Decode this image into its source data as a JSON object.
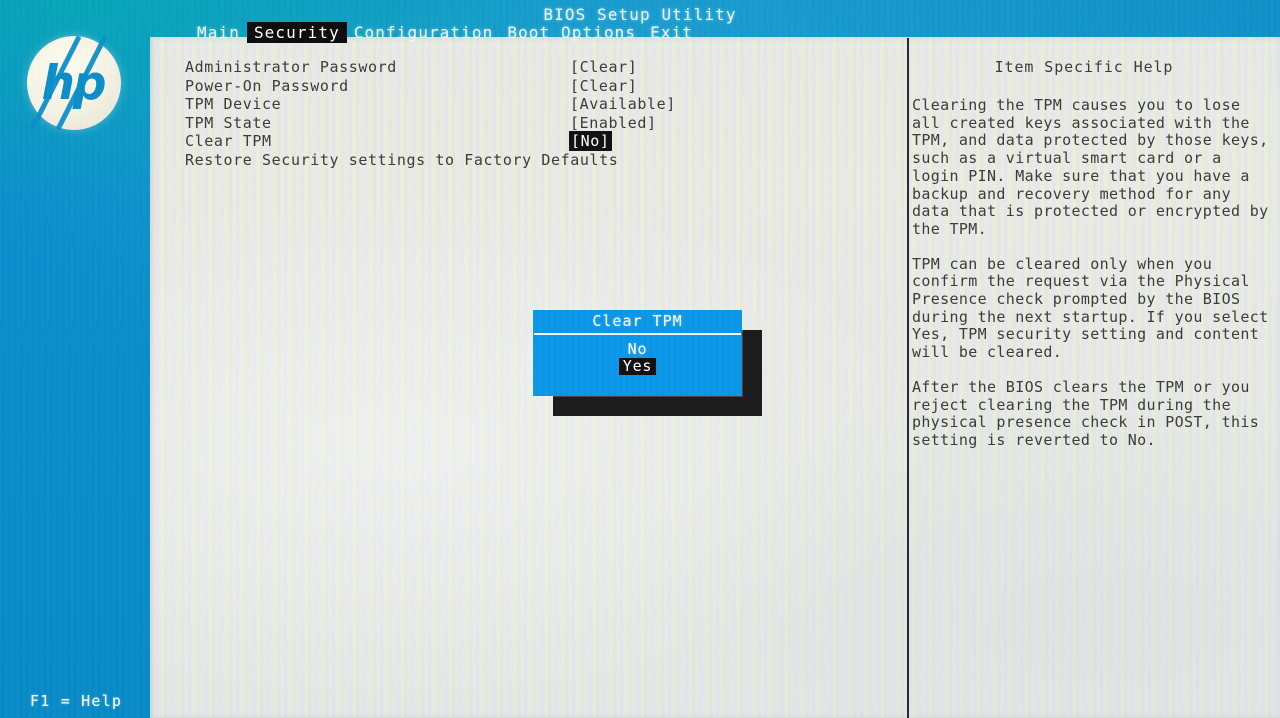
{
  "app": {
    "title": "BIOS Setup Utility",
    "vendor_logo": "hp-logo",
    "logo_text": "hp"
  },
  "menubar": {
    "items": [
      {
        "label": "Main",
        "active": false
      },
      {
        "label": "Security",
        "active": true
      },
      {
        "label": "Configuration",
        "active": false
      },
      {
        "label": "Boot Options",
        "active": false
      },
      {
        "label": "Exit",
        "active": false
      }
    ]
  },
  "settings": {
    "rows": [
      {
        "label": "Administrator Password",
        "value": "[Clear]",
        "selected": false
      },
      {
        "label": "Power-On Password",
        "value": "[Clear]",
        "selected": false
      },
      {
        "label": "TPM Device",
        "value": "[Available]",
        "selected": false
      },
      {
        "label": "TPM State",
        "value": "[Enabled]",
        "selected": false
      },
      {
        "label": "Clear TPM",
        "value": "[No]",
        "selected": true
      },
      {
        "label": "Restore Security settings to Factory Defaults",
        "value": "",
        "selected": false
      }
    ]
  },
  "help": {
    "title": "Item Specific Help",
    "paragraphs": [
      "Clearing the TPM causes you to lose all created keys associated with the TPM, and data protected by those keys, such as a virtual smart card or a login PIN. Make sure that you have a backup and recovery method for any data that is protected or encrypted by the TPM.",
      "TPM can be cleared only when you confirm the request via the Physical Presence check prompted by the BIOS during the next startup. If you select Yes, TPM security setting and content will be cleared.",
      "After the BIOS clears the TPM or you reject clearing the TPM during the physical presence check in POST, this setting is reverted to No."
    ]
  },
  "dialog": {
    "title": "Clear TPM",
    "options": [
      {
        "label": "No",
        "selected": false
      },
      {
        "label": "Yes",
        "selected": true
      }
    ]
  },
  "statusbar": {
    "hint": "F1 = Help"
  },
  "colors": {
    "rail_blue": "#0c8ecb",
    "dialog_blue": "#0c96e8",
    "highlight_black": "#111111",
    "panel_light": "#e7eadf",
    "text_dark": "#3b3b3b",
    "text_white": "#ffffff"
  }
}
